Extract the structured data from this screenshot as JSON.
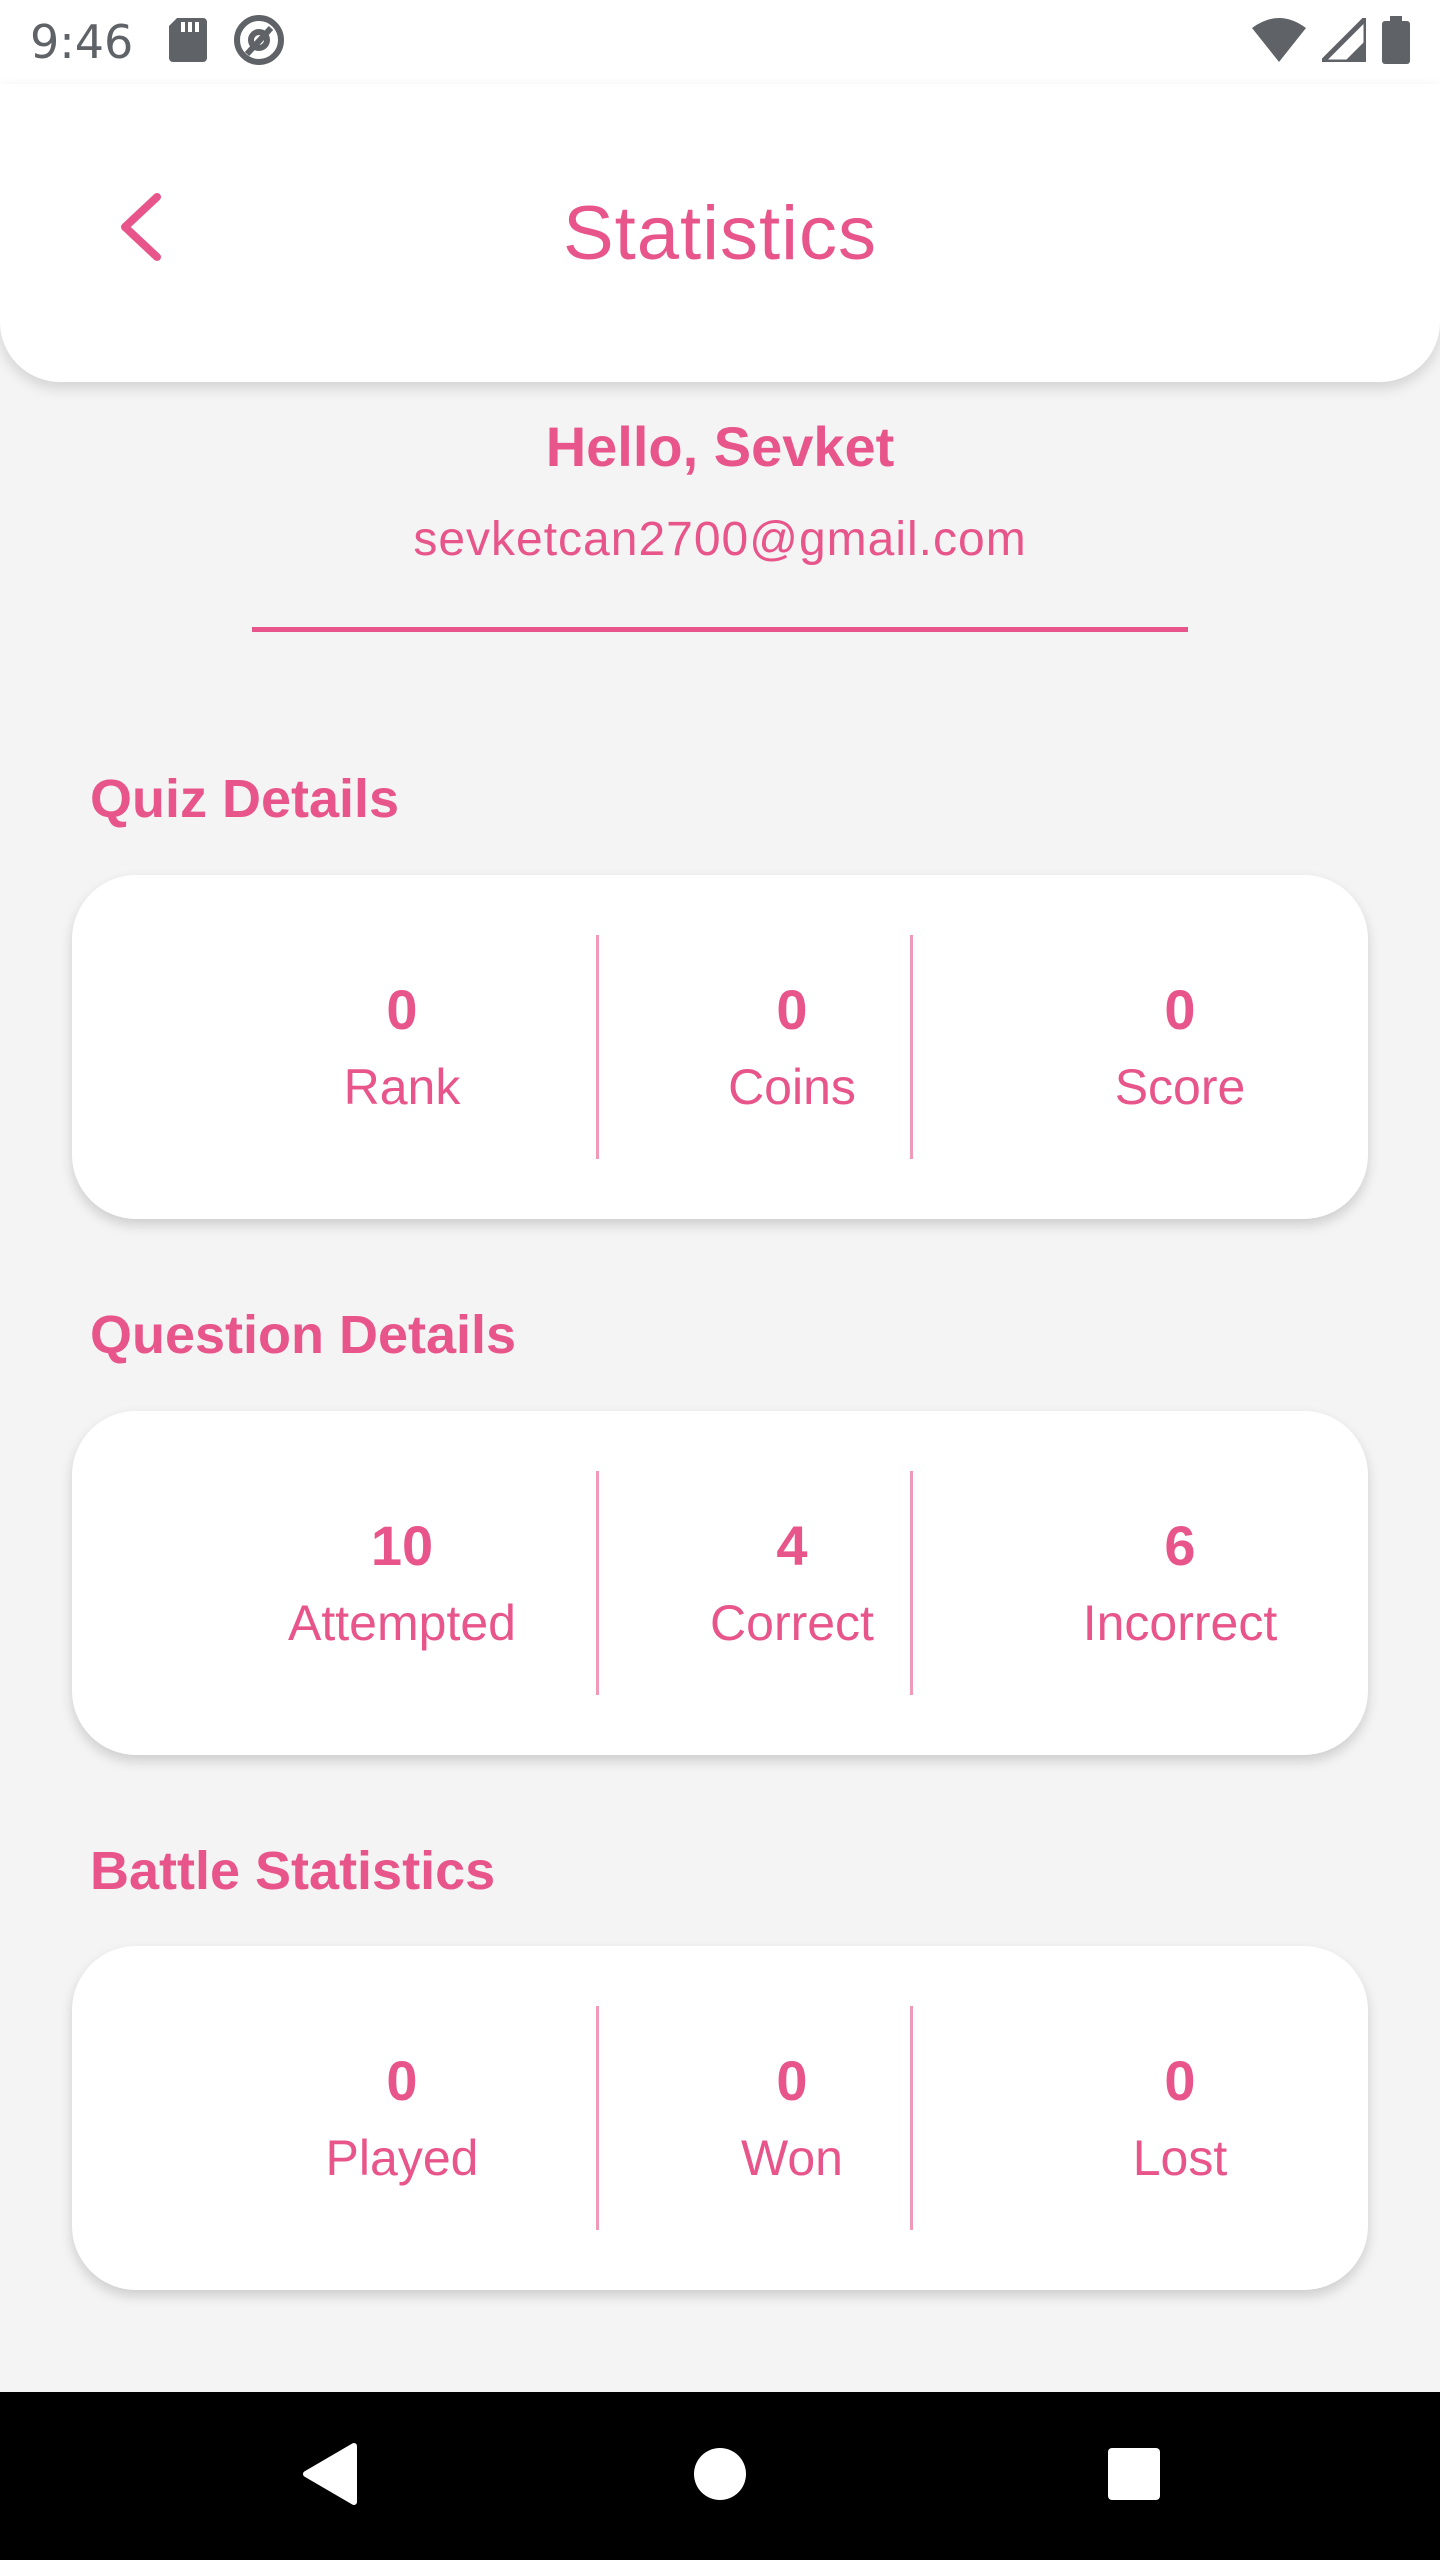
{
  "status_bar": {
    "time": "9:46",
    "icons_left": [
      "sd-card-icon",
      "at-sign-icon"
    ],
    "icons_right": [
      "wifi-icon",
      "signal-icon",
      "battery-icon"
    ]
  },
  "header": {
    "title": "Statistics",
    "back_icon": "chevron-left-icon"
  },
  "user": {
    "greeting": "Hello, Sevket",
    "email": "sevketcan2700@gmail.com"
  },
  "sections": {
    "quiz": {
      "title": "Quiz Details",
      "stats": [
        {
          "value": "0",
          "label": "Rank"
        },
        {
          "value": "0",
          "label": "Coins"
        },
        {
          "value": "0",
          "label": "Score"
        }
      ]
    },
    "question": {
      "title": "Question Details",
      "stats": [
        {
          "value": "10",
          "label": "Attempted"
        },
        {
          "value": "4",
          "label": "Correct"
        },
        {
          "value": "6",
          "label": "Incorrect"
        }
      ]
    },
    "battle": {
      "title": "Battle Statistics",
      "stats": [
        {
          "value": "0",
          "label": "Played"
        },
        {
          "value": "0",
          "label": "Won"
        },
        {
          "value": "0",
          "label": "Lost"
        }
      ]
    }
  },
  "nav_bar": {
    "back_icon": "triangle-back-icon",
    "home_icon": "circle-home-icon",
    "recents_icon": "square-recents-icon"
  },
  "colors": {
    "accent": "#e8558a",
    "background": "#f4f4f4",
    "card": "#ffffff"
  }
}
